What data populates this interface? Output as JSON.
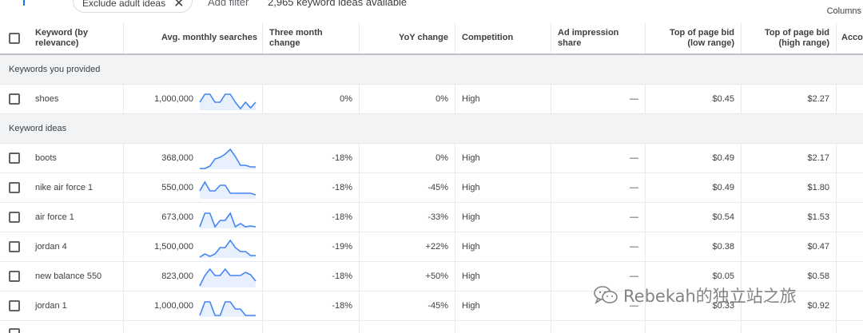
{
  "topbar": {
    "filter_icon": "filter-icon",
    "chip_label": "Exclude adult ideas",
    "chip_close": "✕",
    "add_filter": "Add filter",
    "ideas_count": "2,965 keyword ideas available",
    "columns_label": "Columns"
  },
  "table": {
    "headers": {
      "keyword": "Keyword (by relevance)",
      "avg": "Avg. monthly searches",
      "three_month": "Three month change",
      "yoy": "YoY change",
      "competition": "Competition",
      "ad_impression": "Ad impression share",
      "low_bid": "Top of page bid (low range)",
      "high_bid": "Top of page bid (high range)",
      "account": "Acco"
    },
    "group_provided": "Keywords you provided",
    "group_ideas": "Keyword ideas",
    "provided_rows": [
      {
        "keyword": "shoes",
        "avg": "1,000,000",
        "three_month": "0%",
        "yoy": "0%",
        "competition": "High",
        "impression": "—",
        "low": "$0.45",
        "high": "$2.27",
        "trend": [
          18,
          8,
          8,
          18,
          18,
          8,
          8,
          18,
          26,
          18,
          25,
          18
        ]
      }
    ],
    "idea_rows": [
      {
        "keyword": "boots",
        "avg": "368,000",
        "three_month": "-18%",
        "yoy": "0%",
        "competition": "High",
        "impression": "—",
        "low": "$0.49",
        "high": "$2.17",
        "trend": [
          27,
          27,
          24,
          15,
          13,
          9,
          3,
          12,
          23,
          23,
          25,
          25
        ]
      },
      {
        "keyword": "nike air force 1",
        "avg": "550,000",
        "three_month": "-18%",
        "yoy": "-45%",
        "competition": "High",
        "impression": "—",
        "low": "$0.49",
        "high": "$1.80",
        "trend": [
          18,
          7,
          18,
          18,
          11,
          11,
          21,
          21,
          21,
          21,
          21,
          23
        ]
      },
      {
        "keyword": "air force 1",
        "avg": "673,000",
        "three_month": "-18%",
        "yoy": "-33%",
        "competition": "High",
        "impression": "—",
        "low": "$0.54",
        "high": "$1.53",
        "trend": [
          26,
          9,
          9,
          26,
          18,
          18,
          9,
          26,
          22,
          26,
          25,
          26
        ]
      },
      {
        "keyword": "jordan 4",
        "avg": "1,500,000",
        "three_month": "-19%",
        "yoy": "+22%",
        "competition": "High",
        "impression": "—",
        "low": "$0.38",
        "high": "$0.47",
        "trend": [
          27,
          23,
          26,
          23,
          15,
          15,
          6,
          15,
          20,
          20,
          25,
          25
        ]
      },
      {
        "keyword": "new balance 550",
        "avg": "823,000",
        "three_month": "-18%",
        "yoy": "+50%",
        "competition": "High",
        "impression": "—",
        "low": "$0.05",
        "high": "$0.58",
        "trend": [
          26,
          13,
          5,
          13,
          13,
          5,
          13,
          13,
          13,
          9,
          12,
          20
        ]
      },
      {
        "keyword": "jordan 1",
        "avg": "1,000,000",
        "three_month": "-18%",
        "yoy": "-45%",
        "competition": "High",
        "impression": "—",
        "low": "$0.33",
        "high": "$0.92",
        "trend": [
          26,
          9,
          9,
          26,
          26,
          9,
          9,
          18,
          18,
          26,
          26,
          26
        ]
      }
    ]
  },
  "watermark": {
    "text": "Rebekah的独立站之旅",
    "icon": "wechat-icon"
  },
  "colors": {
    "accent": "#4285f4",
    "spark_fill": "#e8f0fe",
    "group_bg": "#f1f3f4"
  }
}
